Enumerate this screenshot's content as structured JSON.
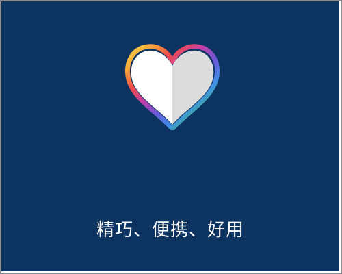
{
  "slide": {
    "background_color": "#0d3461",
    "tagline": "精巧、便携、好用"
  },
  "icon": {
    "name": "heart-icon",
    "left_half_color": "#ffffff",
    "right_half_color": "#dcdcdc",
    "rainbow_outline": [
      "#f9e04a",
      "#f6a23b",
      "#ef4a4a",
      "#c341a8",
      "#6a57d8",
      "#3f8ee8",
      "#43c36a",
      "#b9dc3e"
    ]
  }
}
